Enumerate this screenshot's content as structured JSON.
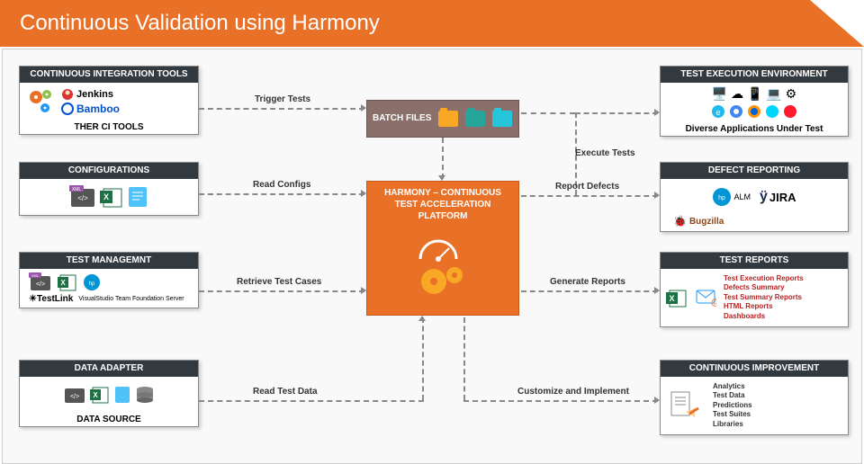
{
  "header": {
    "title": "Continuous Validation using Harmony"
  },
  "left_boxes": {
    "ci": {
      "header": "CONTINUOUS INTEGRATION TOOLS",
      "footer": "THER CI TOOLS",
      "jenkins": "Jenkins",
      "bamboo": "Bamboo"
    },
    "config": {
      "header": "CONFIGURATIONS"
    },
    "testmgmt": {
      "header": "TEST MANAGEMNT",
      "testlink": "TestLink",
      "tfs": "VisualStudio Team Foundation Server"
    },
    "adapter": {
      "header": "DATA ADAPTER",
      "footer": "DATA SOURCE"
    }
  },
  "center": {
    "batch": "BATCH FILES",
    "platform": "HARMONY – CONTINUOUS TEST ACCELERATION PLATFORM"
  },
  "right_boxes": {
    "env": {
      "header": "TEST EXECUTION ENVIRONMENT",
      "footer": "Diverse Applications Under Test"
    },
    "defect": {
      "header": "DEFECT REPORTING",
      "alm": "ALM",
      "jira": "JIRA",
      "bugzilla": "Bugzilla"
    },
    "reports": {
      "header": "TEST REPORTS",
      "items": [
        "Test Execution Reports",
        "Defects Summary",
        "Test Summary Reports",
        "HTML Reports",
        "Dashboards"
      ]
    },
    "improve": {
      "header": "CONTINUOUS IMPROVEMENT",
      "items": [
        "Analytics",
        "Test Data",
        "Predictions",
        "Test Suites",
        "Libraries"
      ]
    }
  },
  "arrows": {
    "trigger": "Trigger Tests",
    "read_config": "Read Configs",
    "retrieve": "Retrieve Test Cases",
    "read_data": "Read Test Data",
    "execute": "Execute Tests",
    "report_defects": "Report Defects",
    "gen_reports": "Generate Reports",
    "customize": "Customize and Implement"
  }
}
